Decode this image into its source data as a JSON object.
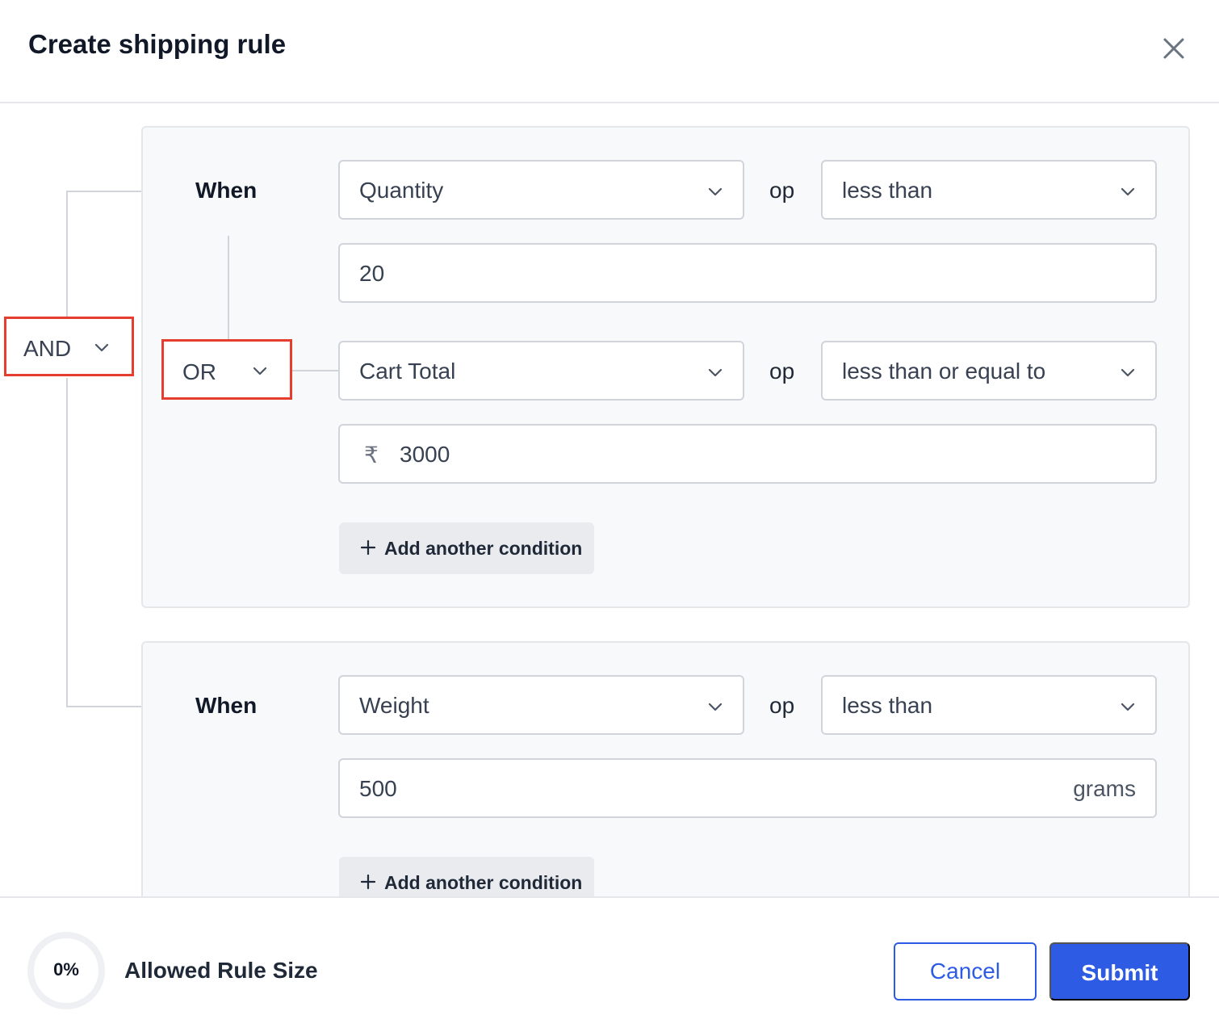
{
  "header": {
    "title": "Create shipping rule",
    "close_icon": "close-icon"
  },
  "root_logic": {
    "value": "AND"
  },
  "groups": [
    {
      "when_label": "When",
      "inner_logic": "OR",
      "conditions": [
        {
          "field": "Quantity",
          "op_label": "op",
          "operator": "less than",
          "value": "20",
          "prefix": "",
          "suffix": ""
        },
        {
          "field": "Cart Total",
          "op_label": "op",
          "operator": "less than or equal to",
          "value": "3000",
          "prefix": "₹",
          "suffix": ""
        }
      ],
      "add_condition_label": "Add another condition"
    },
    {
      "when_label": "When",
      "conditions": [
        {
          "field": "Weight",
          "op_label": "op",
          "operator": "less than",
          "value": "500",
          "prefix": "",
          "suffix": "grams"
        }
      ],
      "add_condition_label": "Add another condition"
    }
  ],
  "footer": {
    "rule_size_percent": "0%",
    "rule_size_label": "Allowed Rule Size",
    "cancel_label": "Cancel",
    "submit_label": "Submit"
  },
  "colors": {
    "primary": "#2d5be3",
    "highlight_border": "#e53e2e",
    "card_background": "#f8f9fb",
    "border": "#d1d5db"
  }
}
